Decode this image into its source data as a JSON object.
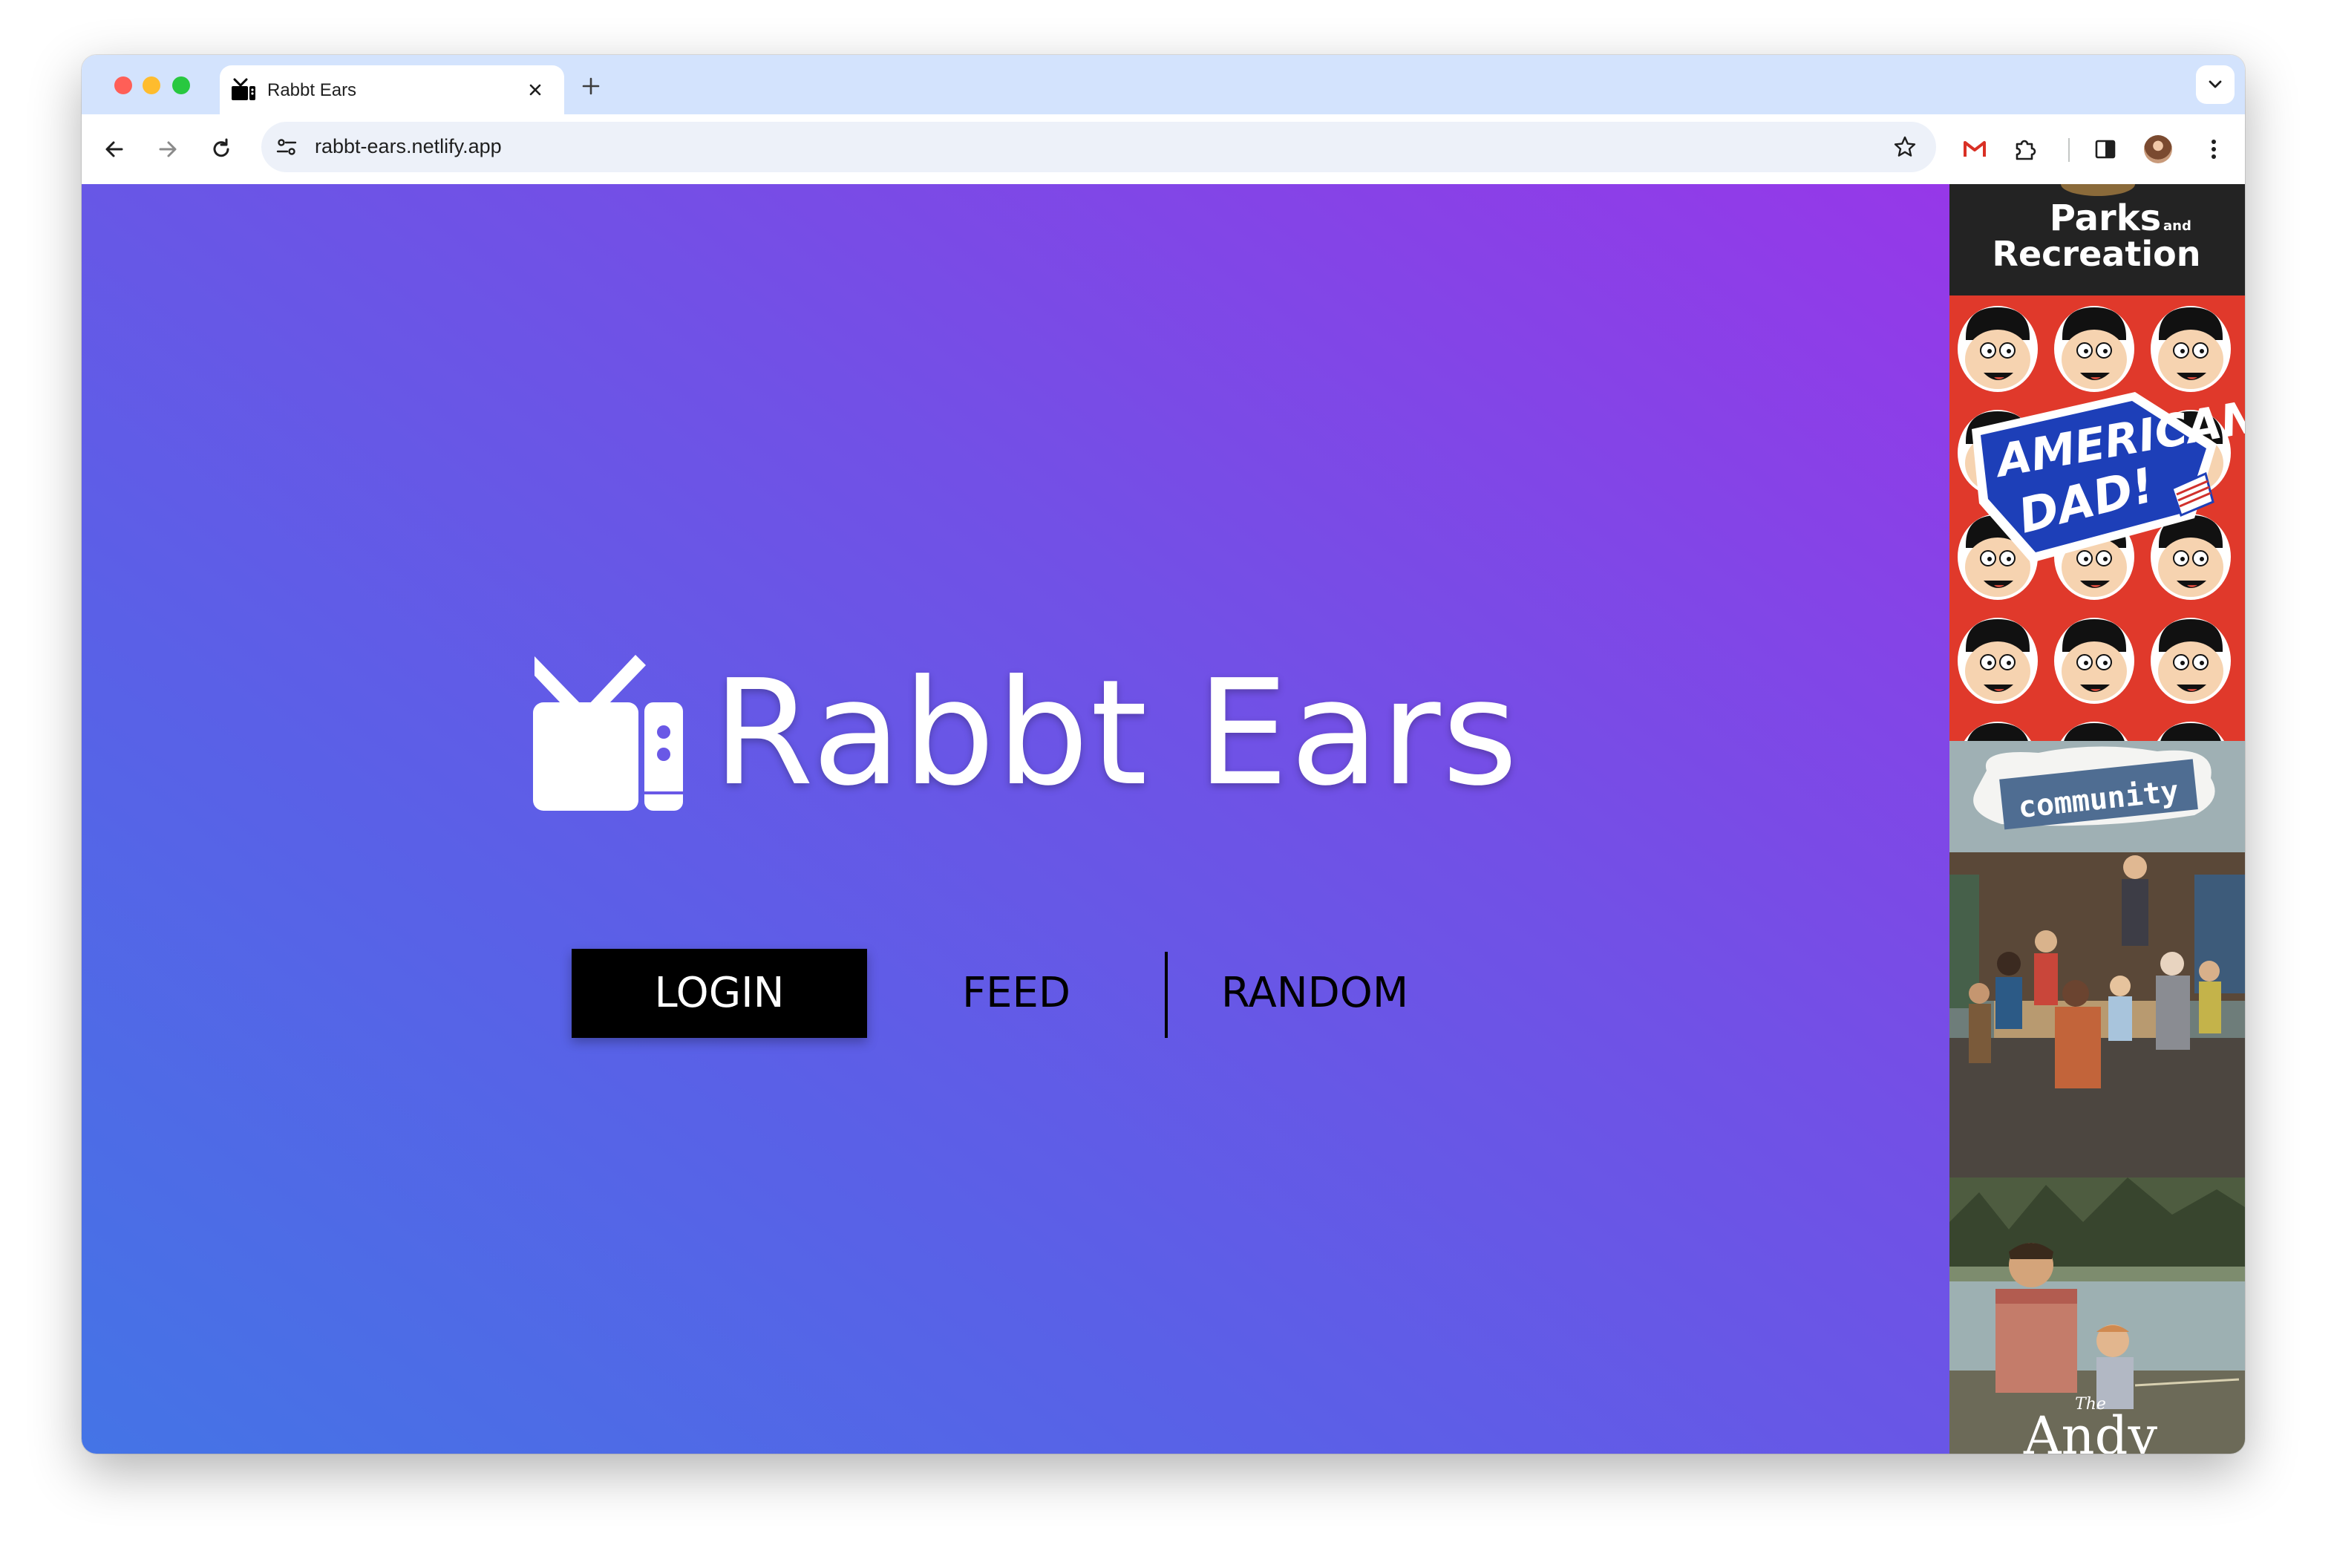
{
  "browser": {
    "tab_title": "Rabbt Ears",
    "url": "rabbt-ears.netlify.app"
  },
  "hero": {
    "logo_text": "Rabbt Ears",
    "nav": {
      "login": "LOGIN",
      "feed": "FEED",
      "random": "RANDOM"
    }
  },
  "posters": [
    {
      "title_line1": "Parks",
      "title_and": "and",
      "title_line2": "Recreation"
    },
    {
      "title_line1": "AMERICAN",
      "title_line2": "DAD!"
    },
    {
      "title": "community"
    },
    {
      "title_small": "The",
      "title": "Andy"
    }
  ],
  "colors": {
    "gradient": [
      "#4474e6",
      "#5a60e7",
      "#7250e6",
      "#9638e8"
    ],
    "tabstrip": "#d3e3fd",
    "login_bg": "#000000"
  }
}
